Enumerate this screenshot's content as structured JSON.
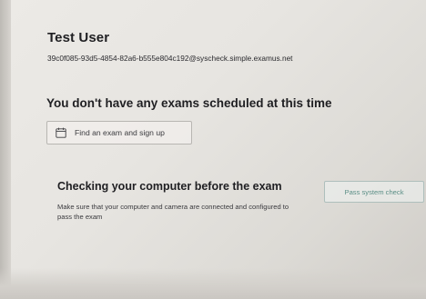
{
  "user": {
    "name": "Test User",
    "email": "39c0f085-93d5-4854-82a6-b555e804c192@syscheck.simple.examus.net"
  },
  "exams": {
    "empty_message": "You don't have any exams scheduled at this time",
    "find_button_label": "Find an exam and sign up",
    "find_button_icon": "calendar-icon"
  },
  "system_check": {
    "title": "Checking your computer before the exam",
    "description": "Make sure that your computer and camera are connected and configured to pass the exam",
    "button_label": "Pass system check"
  },
  "colors": {
    "accent": "#5c8f87",
    "text": "#1f1f22"
  }
}
